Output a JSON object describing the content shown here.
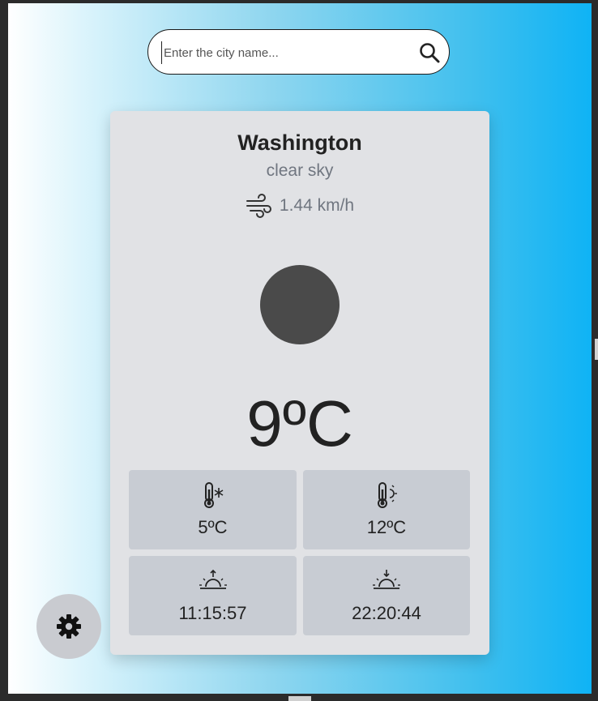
{
  "search": {
    "placeholder": "Enter the city name...",
    "icon": "search-icon"
  },
  "weather": {
    "city": "Washington",
    "description": "clear sky",
    "wind_speed": "1.44 km/h",
    "wind_icon": "wind-icon",
    "condition_icon": "weather-condition-icon",
    "temperature": "9ºC"
  },
  "stats": {
    "min_temp": "5ºC",
    "min_temp_icon": "thermometer-cold-icon",
    "max_temp": "12ºC",
    "max_temp_icon": "thermometer-warm-icon",
    "sunrise": "11:15:57",
    "sunrise_icon": "sunrise-icon",
    "sunset": "22:20:44",
    "sunset_icon": "sunset-icon"
  },
  "settings": {
    "icon": "gear-icon"
  },
  "colors": {
    "gradient_start": "#ffffff",
    "gradient_end": "#0fb3f5",
    "card_background": "#e1e2e5",
    "tile_background": "#c8ccd3",
    "secondary_text": "#707680"
  }
}
